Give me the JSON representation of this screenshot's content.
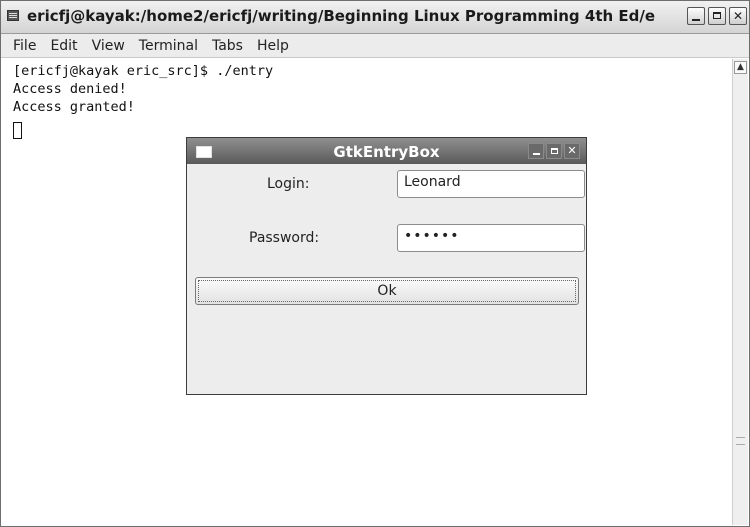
{
  "terminal": {
    "title": "ericfj@kayak:/home2/ericfj/writing/Beginning Linux Programming 4th Ed/e",
    "menu": [
      "File",
      "Edit",
      "View",
      "Terminal",
      "Tabs",
      "Help"
    ],
    "lines": [
      "[ericfj@kayak eric_src]$ ./entry",
      "Access denied!",
      "Access granted!"
    ]
  },
  "dialog": {
    "title": "GtkEntryBox",
    "login_label": "Login:",
    "login_value": "Leonard",
    "password_label": "Password:",
    "password_value": "••••••",
    "ok_label": "Ok"
  }
}
